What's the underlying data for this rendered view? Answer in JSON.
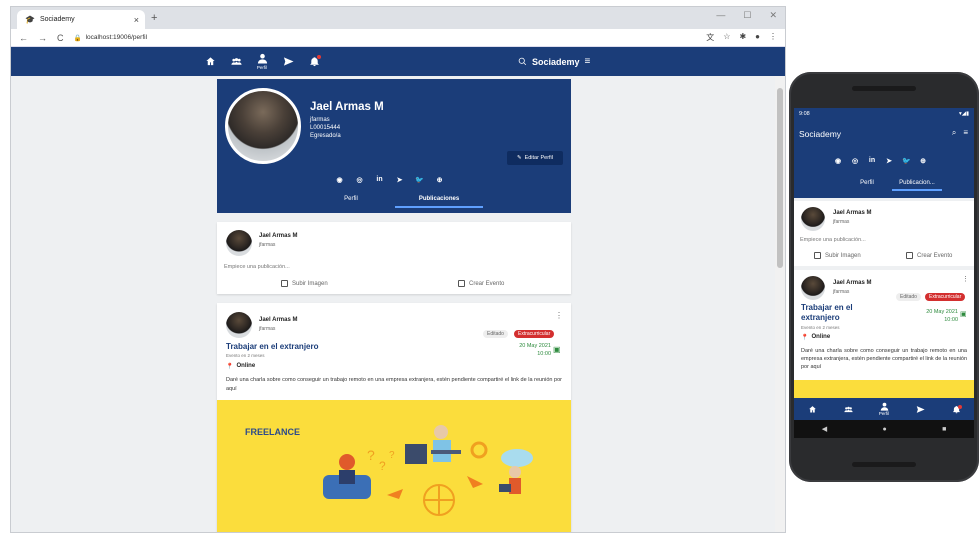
{
  "browser": {
    "tab_title": "Sociademy",
    "url": "localhost:19006/perfil",
    "new_tab": "+",
    "close": "×"
  },
  "app": {
    "brand": "Sociademy",
    "active_nav_label": "Perfil",
    "nav_icons": [
      "home-icon",
      "groups-icon",
      "person-icon",
      "send-icon",
      "notifications-icon"
    ]
  },
  "profile": {
    "name": "Jael Armas M",
    "username": "jfarmas",
    "code": "L00015444",
    "status": "Egresado/a",
    "edit_label": "Editar Perfil",
    "social": [
      "github-icon",
      "instagram-icon",
      "linkedin-icon",
      "telegram-icon",
      "twitter-icon",
      "web-icon"
    ],
    "tabs": [
      "Perfil",
      "Publicaciones"
    ],
    "active_tab": "Publicaciones"
  },
  "compose": {
    "name": "Jael Armas M",
    "handle": "jfarmas",
    "placeholder": "Empiece una publicación...",
    "upload_label": "Subir Imagen",
    "event_label": "Crear Evento"
  },
  "post": {
    "name": "Jael Armas M",
    "handle": "jfarmas",
    "edited": "Editado",
    "category": "Extracurricular",
    "title": "Trabajar en el extranjero",
    "subtitle": "Evento en 2 meses",
    "date": "20 May 2021",
    "time": "10:00",
    "mode": "Online",
    "description": "Daré una charla sobre como conseguir un trabajo remoto en una empresa extranjera, estén pendiente compartiré el link de la reunión por aquí",
    "image_text": "FREELANCE"
  },
  "mobile": {
    "time": "9:08",
    "app_title": "Sociademy",
    "tabs": [
      "Perfil",
      "Publicacion..."
    ],
    "name": "Jael Armas M",
    "handle": "jfarmas",
    "placeholder": "Empiece una publicación...",
    "upload_label": "Subir Imagen",
    "event_label": "Crear Evento",
    "edited": "Editado",
    "category": "Extracurricular",
    "title_line1": "Trabajar en el",
    "title_line2": "extranjero",
    "subtitle": "Evento en 2 meses",
    "date": "20 May 2021",
    "time_event": "10:00",
    "mode": "Online",
    "description": "Daré una charla sobre como conseguir un trabajo remoto en una empresa extranjera, estén pendiente compartiré el link de la reunión por aquí",
    "nav_label": "Perfil"
  },
  "colors": {
    "primary": "#1b3d79",
    "accent_red": "#d32f2f",
    "date_green": "#2e8b3e",
    "banner_yellow": "#fbdd3c"
  }
}
